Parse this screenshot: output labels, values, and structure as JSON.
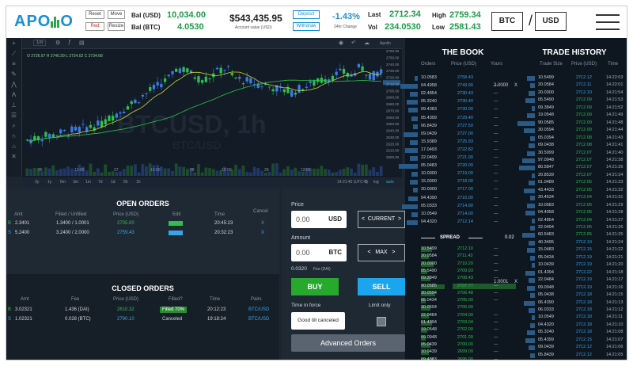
{
  "header": {
    "logo": "APO",
    "logo_tail": "O",
    "buttons": {
      "reset": "Reset",
      "move": "Move",
      "red": "Red",
      "resize": "Resize"
    },
    "bal_usd_label": "Bal (USD)",
    "bal_usd": "10,034.00",
    "bal_btc_label": "Bal (BTC)",
    "bal_btc": "4.0530",
    "account_value": "$543,435.95",
    "account_value_label": "Account value (USD)",
    "deposit": "Deposit",
    "withdraw": "Withdraw",
    "change": "-1.43%",
    "change_label": "24hr Change",
    "last_label": "Last",
    "last": "2712.34",
    "vol_label": "Vol",
    "vol": "234.0530",
    "high_label": "High",
    "high": "2759.34",
    "low_label": "Low",
    "low": "2581.43",
    "base": "BTC",
    "quote": "USD",
    "slash": "/"
  },
  "chart": {
    "legend": "O 2726.97  H 2740.29  L 2724.02  C 2734.68",
    "watermark": "BTCUSD, 1h",
    "watermark2": "BTC/USD",
    "toolbar_interval": "1m",
    "toolbar_right": "Apollo",
    "y_ticks": [
      "2760.00",
      "2750.00",
      "2740.00",
      "2730.00",
      "2720.00",
      "2710.00",
      "2700.00",
      "2690.00",
      "2680.00",
      "2670.00",
      "2660.00",
      "2650.00",
      "2640.00",
      "2630.00",
      "2620.00",
      "2610.00",
      "2600.00"
    ],
    "x_ticks": [
      "26",
      "12:00",
      "27",
      "12:00",
      "28",
      "12:00",
      "29",
      "12:00"
    ],
    "ranges": [
      "3y",
      "1y",
      "6m",
      "3m",
      "1m",
      "7d",
      "1d",
      "5h",
      "1h"
    ],
    "bottom_right": [
      "14:21:46 (UTC-3)",
      "%",
      "log",
      "auto"
    ],
    "colors": {
      "up": "#2ec04f",
      "down": "#3a7be8",
      "ma": "#c9d43a",
      "ma2": "#2ec04f"
    }
  },
  "open_orders": {
    "title": "OPEN ORDERS",
    "columns": [
      "Amt",
      "Filled / Unfilled",
      "Price (USD)",
      "Edit",
      "Time",
      "Cancel"
    ],
    "rows": [
      {
        "side": "B",
        "amt": "2.3401",
        "filled": "1.3400 / 1.0001",
        "price": "2705.00",
        "time": "20:45:23",
        "cancel": "X"
      },
      {
        "side": "S",
        "amt": "5.2400",
        "filled": "3.2400 / 2.0000",
        "price": "2759.43",
        "time": "20:32:23",
        "cancel": "X"
      }
    ]
  },
  "closed_orders": {
    "title": "CLOSED ORDERS",
    "columns": [
      "Amt",
      "Fee",
      "Price (USD)",
      "Filled?",
      "Time",
      "Pairs"
    ],
    "rows": [
      {
        "side": "B",
        "amt": "3.02321",
        "fee": "1.436 (DAI)",
        "price": "2610.32",
        "filled": "Filled 70%",
        "time": "20:12:23",
        "pair": "BTC/USD"
      },
      {
        "side": "S",
        "amt": "1.02321",
        "fee": "0.028 (BTC)",
        "price": "2790.10",
        "filled": "Canceled",
        "time": "19:18:24",
        "pair": "BTC/USD"
      }
    ]
  },
  "trade": {
    "price_label": "Price",
    "price_value": "0.00",
    "price_unit": "USD",
    "current": "CURRENT",
    "amount_label": "Amount",
    "amount_value": "0.00",
    "amount_unit": "BTC",
    "max": "MAX",
    "fee": "0.0320",
    "fee_label": "Fee (DAI)",
    "buy": "BUY",
    "sell": "SELL",
    "tif_label": "Time in force",
    "limit_label": "Limit only",
    "tif_value": "Good till canceled",
    "advanced": "Advanced Orders"
  },
  "book": {
    "title": "THE BOOK",
    "columns": [
      "Orders",
      "Price (USD)",
      "Yours"
    ],
    "asks": [
      [
        "10.0583",
        "2758.43",
        ""
      ],
      [
        "04.4958",
        "2743.90",
        ""
      ],
      [
        "02.4854",
        "2730.43",
        ""
      ],
      [
        "05.3240",
        "2730.40",
        ""
      ],
      [
        "09.4383",
        "2730.00",
        ""
      ],
      [
        "05.4399",
        "2729.40",
        ""
      ],
      [
        "06.8439",
        "2727.50",
        ""
      ],
      [
        "09.0439",
        "2727.00",
        ""
      ],
      [
        "15.9389",
        "2725.93",
        ""
      ],
      [
        "17.0493",
        "2722.82",
        ""
      ],
      [
        "22.0499",
        "2721.00",
        ""
      ],
      [
        "05.0483",
        "2720.00",
        ""
      ],
      [
        "10.0000",
        "2719.00",
        ""
      ],
      [
        "15.0000",
        "2718.00",
        ""
      ],
      [
        "20.0000",
        "2717.00",
        ""
      ],
      [
        "04.4390",
        "2716.00",
        ""
      ],
      [
        "05.0333",
        "2714.90",
        ""
      ],
      [
        "10.0549",
        "2714.00",
        ""
      ],
      [
        "04.4320",
        "2712.14",
        ""
      ]
    ],
    "yours_ask": "2.0000",
    "yours_ask_x": "X",
    "spread_label": "SPREAD",
    "spread": "0.02",
    "bids": [
      [
        "10.5499",
        "2712.10",
        ""
      ],
      [
        "20.0584",
        "2711.43",
        ""
      ],
      [
        "20.0000",
        "2710.20",
        ""
      ],
      [
        "05.5490",
        "2709.93",
        ""
      ],
      [
        "09.3849",
        "2708.43",
        ""
      ],
      [
        "90.0585",
        "2707.77",
        ""
      ],
      [
        "30.0594",
        "2706.48",
        ""
      ],
      [
        "05.0434",
        "2705.00",
        ""
      ],
      [
        "30.0594",
        "2706.99",
        ""
      ],
      [
        "22.0484",
        "2704.00",
        ""
      ],
      [
        "01.4394",
        "2703.04",
        ""
      ],
      [
        "19.0548",
        "2702.00",
        ""
      ],
      [
        "09.0948",
        "2701.09",
        ""
      ],
      [
        "05.0439",
        "2700.00",
        ""
      ],
      [
        "10.0439",
        "2699.00",
        ""
      ],
      [
        "09.4383",
        "2695.00",
        ""
      ],
      [
        "30.5393",
        "2695.00",
        ""
      ],
      [
        "30.0948",
        "2694.00",
        ""
      ],
      [
        "30.9847",
        "2693.00",
        ""
      ]
    ],
    "yours_bid": "1.0001",
    "yours_bid_x": "X"
  },
  "history": {
    "title": "TRADE HISTORY",
    "columns": [
      "Trade Size",
      "Price (USD)",
      "Time"
    ],
    "rows": [
      [
        "10.5499",
        "2712.12",
        "14:22:03"
      ],
      [
        "20.0584",
        "2712.11",
        "14:22:01"
      ],
      [
        "20.0000",
        "2712.10",
        "14:21:54"
      ],
      [
        "05.5490",
        "2712.09",
        "14:21:53"
      ],
      [
        "09.3849",
        "2712.09",
        "14:21:52"
      ],
      [
        "19.0548",
        "2712.09",
        "14:21:49"
      ],
      [
        "90.0585",
        "2712.09",
        "14:21:48"
      ],
      [
        "30.0594",
        "2712.09",
        "14:21:44"
      ],
      [
        "05.0394",
        "2712.08",
        "14:21:43"
      ],
      [
        "09.0438",
        "2712.08",
        "14:21:41"
      ],
      [
        "30.5999",
        "2712.07",
        "14:21:40"
      ],
      [
        "97.0948",
        "2712.07",
        "14:21:38"
      ],
      [
        "80.5847",
        "2712.07",
        "14:21:36"
      ],
      [
        "20.8539",
        "2712.07",
        "14:21:34"
      ],
      [
        "01.0489",
        "2712.05",
        "14:21:33"
      ],
      [
        "43.4433",
        "2712.05",
        "14:21:32"
      ],
      [
        "20.4534",
        "2712.04",
        "14:21:31"
      ],
      [
        "10.0583",
        "2712.05",
        "14:21:29"
      ],
      [
        "04.4958",
        "2712.05",
        "14:21:28"
      ],
      [
        "02.4854",
        "2712.04",
        "14:21:27"
      ],
      [
        "22.0494",
        "2712.05",
        "14:21:26"
      ],
      [
        "60.5483",
        "2712.05",
        "14:21:25"
      ],
      [
        "40.3495",
        "2712.19",
        "14:21:24"
      ],
      [
        "15.0483",
        "2712.15",
        "14:21:22"
      ],
      [
        "05.0434",
        "2712.19",
        "14:21:21"
      ],
      [
        "10.0439",
        "2712.19",
        "14:21:20"
      ],
      [
        "01.4394",
        "2712.22",
        "14:21:18"
      ],
      [
        "22.0484",
        "2712.19",
        "14:21:17"
      ],
      [
        "09.0948",
        "2712.19",
        "14:21:16"
      ],
      [
        "05.0438",
        "2712.18",
        "14:21:15"
      ],
      [
        "06.4390",
        "2712.18",
        "14:21:13"
      ],
      [
        "06.0333",
        "2712.18",
        "14:21:12"
      ],
      [
        "10.0549",
        "2712.18",
        "14:21:11"
      ],
      [
        "04.4320",
        "2712.18",
        "14:21:10"
      ],
      [
        "05.3240",
        "2712.18",
        "14:21:08"
      ],
      [
        "05.4399",
        "2712.15",
        "14:21:07"
      ],
      [
        "09.0439",
        "2712.12",
        "14:21:06"
      ],
      [
        "05.8439",
        "2712.12",
        "14:21:05"
      ],
      [
        "10.0549",
        "2712.12",
        "14:21:04"
      ]
    ]
  }
}
